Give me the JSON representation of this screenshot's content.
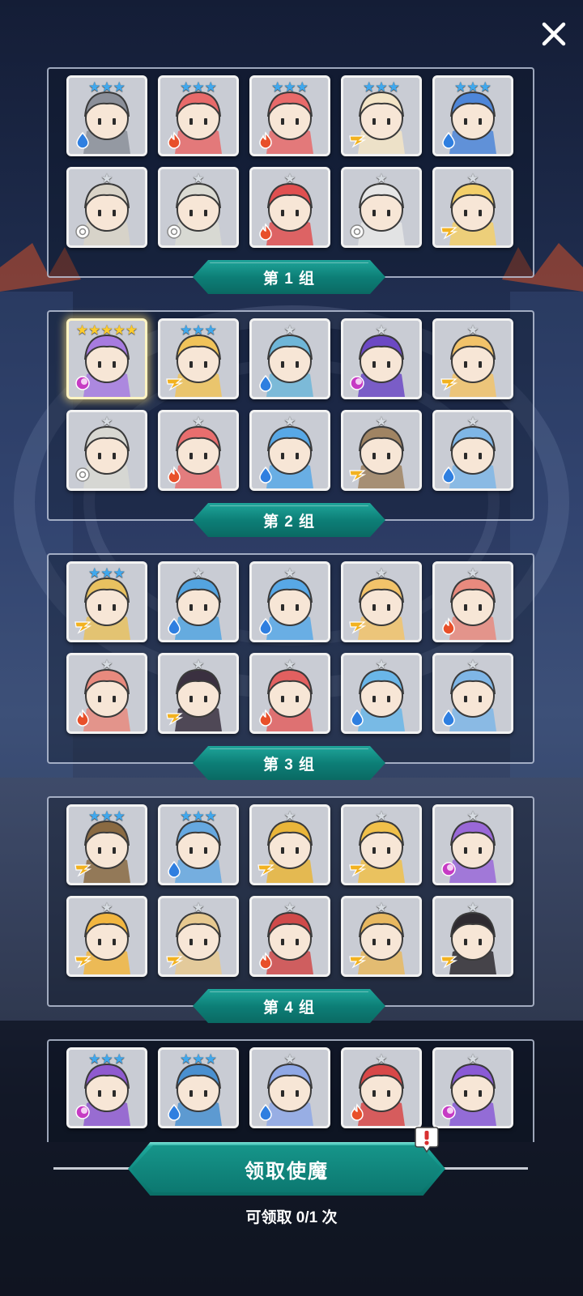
{
  "header": {
    "close_icon": "close-icon"
  },
  "groups": [
    {
      "label": "第 1 组",
      "cards": [
        {
          "stars": 3,
          "star_color": "blue",
          "element": "water",
          "hero": "knight",
          "color": "#8b8f99"
        },
        {
          "stars": 3,
          "star_color": "blue",
          "element": "fire",
          "hero": "queen",
          "color": "#e86a6a"
        },
        {
          "stars": 3,
          "star_color": "blue",
          "element": "fire",
          "hero": "queen",
          "color": "#e86a6a"
        },
        {
          "stars": 3,
          "star_color": "blue",
          "element": "light",
          "hero": "angel",
          "color": "#f3e4c6"
        },
        {
          "stars": 3,
          "star_color": "blue",
          "element": "water",
          "hero": "priestess",
          "color": "#4e86d8"
        },
        {
          "stars": 1,
          "star_color": "gray",
          "element": "wind",
          "hero": "elf",
          "color": "#d9d3c7"
        },
        {
          "stars": 1,
          "star_color": "gray",
          "element": "wind",
          "hero": "cactus",
          "color": "#dadad2"
        },
        {
          "stars": 1,
          "star_color": "gray",
          "element": "fire",
          "hero": "dragon",
          "color": "#e05050"
        },
        {
          "stars": 1,
          "star_color": "gray",
          "element": "wind",
          "hero": "bride",
          "color": "#e6e6e6"
        },
        {
          "stars": 1,
          "star_color": "gray",
          "element": "light",
          "hero": "sheep",
          "color": "#f3cf6a"
        }
      ]
    },
    {
      "label": "第 2 组",
      "cards": [
        {
          "stars": 5,
          "star_color": "gold",
          "element": "dark",
          "hero": "ninja",
          "color": "#a77be0",
          "gold": true
        },
        {
          "stars": 3,
          "star_color": "blue",
          "element": "light",
          "hero": "mummy",
          "color": "#f0c35a"
        },
        {
          "stars": 1,
          "star_color": "gray",
          "element": "water",
          "hero": "mummy-blue",
          "color": "#6fb6d8"
        },
        {
          "stars": 1,
          "star_color": "gray",
          "element": "dark",
          "hero": "treant",
          "color": "#6c49c4"
        },
        {
          "stars": 1,
          "star_color": "gray",
          "element": "light",
          "hero": "fox-girl",
          "color": "#f2c36a"
        },
        {
          "stars": 1,
          "star_color": "gray",
          "element": "wind",
          "hero": "shark",
          "color": "#d8d8d2"
        },
        {
          "stars": 1,
          "star_color": "gray",
          "element": "fire",
          "hero": "cat-mage",
          "color": "#e86e6e"
        },
        {
          "stars": 1,
          "star_color": "gray",
          "element": "water",
          "hero": "blue-dragon",
          "color": "#58a8e6"
        },
        {
          "stars": 1,
          "star_color": "gray",
          "element": "light",
          "hero": "paladin",
          "color": "#a08463"
        },
        {
          "stars": 1,
          "star_color": "gray",
          "element": "water",
          "hero": "winged-knight",
          "color": "#7fb6e6"
        }
      ]
    },
    {
      "label": "第 3 组",
      "cards": [
        {
          "stars": 3,
          "star_color": "blue",
          "element": "light",
          "hero": "witch",
          "color": "#e8c160"
        },
        {
          "stars": 1,
          "star_color": "gray",
          "element": "water",
          "hero": "cat-mage-blue",
          "color": "#54a4e0"
        },
        {
          "stars": 1,
          "star_color": "gray",
          "element": "water",
          "hero": "blue-dragon",
          "color": "#58a8e6"
        },
        {
          "stars": 1,
          "star_color": "gray",
          "element": "light",
          "hero": "fox-girl-2",
          "color": "#f2c36a"
        },
        {
          "stars": 1,
          "star_color": "gray",
          "element": "fire",
          "hero": "hermit-crab",
          "color": "#e88a7e"
        },
        {
          "stars": 1,
          "star_color": "gray",
          "element": "fire",
          "hero": "hermit-crab",
          "color": "#e88a7e"
        },
        {
          "stars": 1,
          "star_color": "gray",
          "element": "light",
          "hero": "dark-hair",
          "color": "#3a3040"
        },
        {
          "stars": 1,
          "star_color": "gray",
          "element": "fire",
          "hero": "imp",
          "color": "#e26060"
        },
        {
          "stars": 1,
          "star_color": "gray",
          "element": "water",
          "hero": "ice-girl",
          "color": "#6ab6e8"
        },
        {
          "stars": 1,
          "star_color": "gray",
          "element": "water",
          "hero": "winged-knight",
          "color": "#7fb6e6"
        }
      ]
    },
    {
      "label": "第 4 组",
      "cards": [
        {
          "stars": 3,
          "star_color": "blue",
          "element": "light",
          "hero": "warlord",
          "color": "#8a6a42"
        },
        {
          "stars": 3,
          "star_color": "blue",
          "element": "water",
          "hero": "yeti",
          "color": "#66a8e0"
        },
        {
          "stars": 1,
          "star_color": "gray",
          "element": "light",
          "hero": "golden-treant",
          "color": "#e9b53a"
        },
        {
          "stars": 1,
          "star_color": "gray",
          "element": "light",
          "hero": "golden-cactus",
          "color": "#f0c04a"
        },
        {
          "stars": 1,
          "star_color": "gray",
          "element": "dark",
          "hero": "venus-trap",
          "color": "#9a68d8"
        },
        {
          "stars": 1,
          "star_color": "gray",
          "element": "light",
          "hero": "skeleton",
          "color": "#f2b640"
        },
        {
          "stars": 1,
          "star_color": "gray",
          "element": "light",
          "hero": "hermit-crab-gold",
          "color": "#e7c990"
        },
        {
          "stars": 1,
          "star_color": "gray",
          "element": "fire",
          "hero": "gladiator",
          "color": "#d04a4a"
        },
        {
          "stars": 1,
          "star_color": "gray",
          "element": "light",
          "hero": "moai",
          "color": "#e8b860"
        },
        {
          "stars": 1,
          "star_color": "gray",
          "element": "light",
          "hero": "emperor",
          "color": "#2e2a30"
        }
      ]
    },
    {
      "label": "",
      "cards": [
        {
          "stars": 3,
          "star_color": "blue",
          "element": "dark",
          "hero": "hooded",
          "color": "#8f5ad0"
        },
        {
          "stars": 3,
          "star_color": "blue",
          "element": "water",
          "hero": "cyclops",
          "color": "#4a90d0"
        },
        {
          "stars": 1,
          "star_color": "gray",
          "element": "water",
          "hero": "ghost",
          "color": "#8fa8e6"
        },
        {
          "stars": 1,
          "star_color": "gray",
          "element": "fire",
          "hero": "red-beast",
          "color": "#d84848"
        },
        {
          "stars": 1,
          "star_color": "gray",
          "element": "dark",
          "hero": "purple-beast",
          "color": "#8a5ad6"
        }
      ]
    }
  ],
  "footer": {
    "claim_button_label": "领取使魔",
    "claim_count_text": "可领取 0/1 次",
    "badge_icon": "exclamation-icon",
    "colors": {
      "accent": "#0f8a80",
      "star_blue": "#3fa8ee",
      "star_gold": "#ffcc2a"
    }
  }
}
